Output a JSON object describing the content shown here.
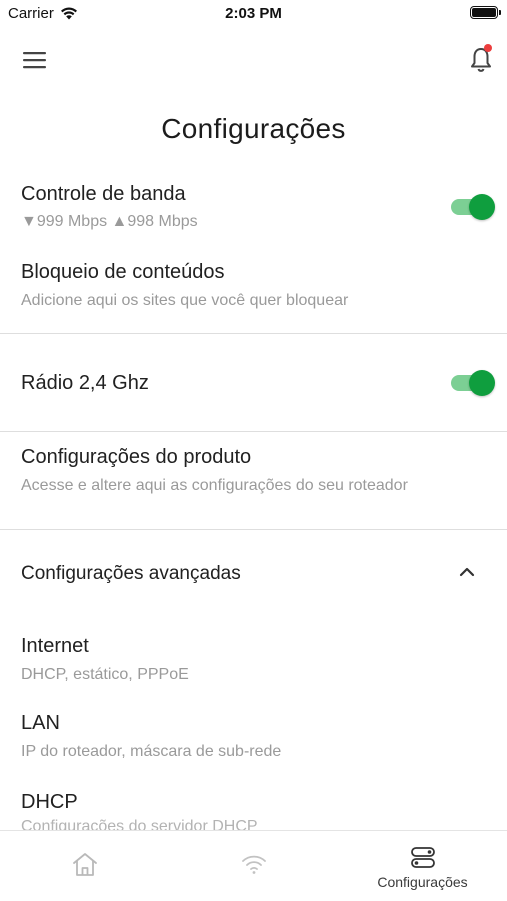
{
  "status_bar": {
    "carrier": "Carrier",
    "time": "2:03 PM",
    "wifi_icon": "wifi-icon",
    "battery_icon": "battery-icon"
  },
  "header": {
    "menu_icon": "hamburger-menu-icon",
    "notification_icon": "bell-icon",
    "notification_badge_color": "#ec3d3d"
  },
  "page": {
    "title": "Configurações"
  },
  "settings": {
    "bandwidth": {
      "title": "Controle de banda",
      "subtitle": "▼999 Mbps ▲998 Mbps",
      "enabled": true
    },
    "content_block": {
      "title": "Bloqueio de conteúdos",
      "subtitle": "Adicione aqui os sites que você quer bloquear"
    },
    "radio": {
      "title": "Rádio 2,4 Ghz",
      "enabled": true
    },
    "product": {
      "title": "Configurações do produto",
      "subtitle": "Acesse e altere aqui as configurações do seu roteador"
    },
    "advanced": {
      "title": "Configurações avançadas",
      "expanded": true,
      "items": [
        {
          "title": "Internet",
          "subtitle": "DHCP, estático, PPPoE"
        },
        {
          "title": "LAN",
          "subtitle": "IP do roteador, máscara de sub-rede"
        },
        {
          "title": "DHCP",
          "subtitle": "Configurações do servidor DHCP"
        }
      ]
    }
  },
  "tabbar": {
    "tabs": [
      {
        "icon": "home-icon",
        "label": ""
      },
      {
        "icon": "wifi-icon",
        "label": ""
      },
      {
        "icon": "settings-toggle-icon",
        "label": "Configurações",
        "active": true
      }
    ]
  },
  "colors": {
    "toggle_on": "#0f9e3e",
    "toggle_track": "#7ccf94",
    "divider": "#dedede",
    "subtitle_text": "#9a9a9a"
  }
}
